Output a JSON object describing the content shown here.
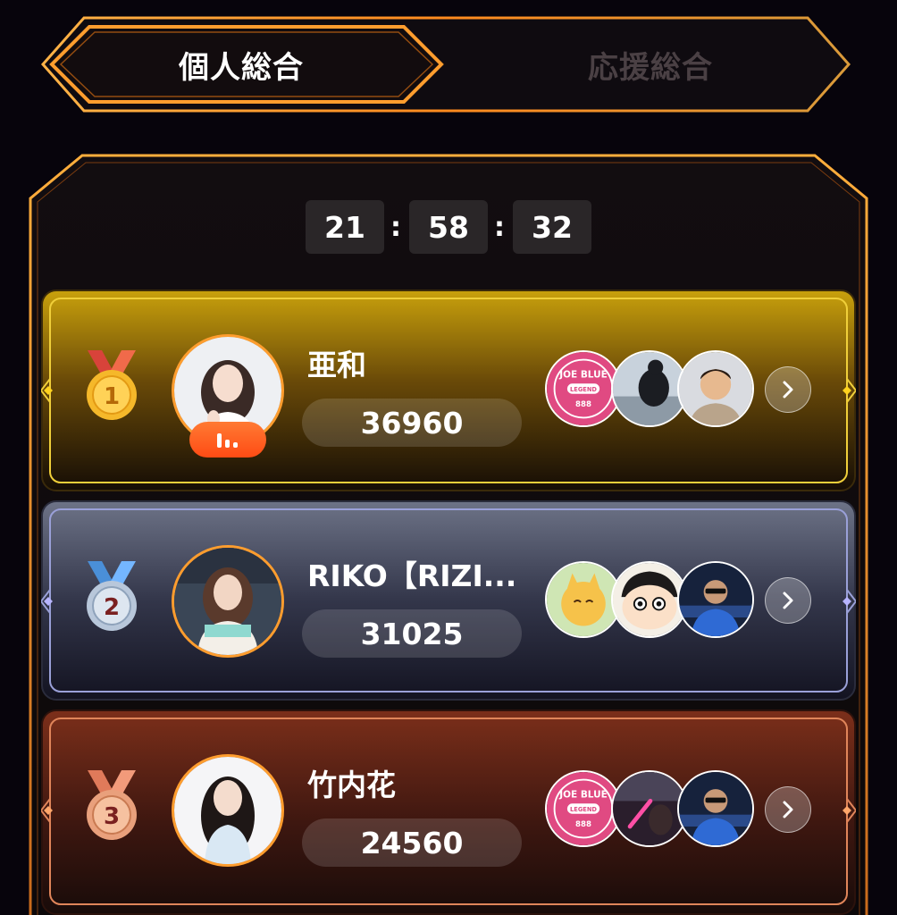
{
  "tabs": [
    {
      "label": "個人総合",
      "active": true
    },
    {
      "label": "応援総合",
      "active": false
    }
  ],
  "timer": {
    "hours": "21",
    "minutes": "58",
    "seconds": "32",
    "separator": ":"
  },
  "ranking": [
    {
      "rank": "1",
      "name": "亜和",
      "score": "36960",
      "theme": "gold",
      "live": true,
      "supporters": [
        "joe-blue-logo-avatar",
        "silhouette-photo-avatar",
        "man-photo-avatar"
      ]
    },
    {
      "rank": "2",
      "name": "RIKO【RIZI...",
      "score": "31025",
      "theme": "silver",
      "live": false,
      "supporters": [
        "yellow-creature-avatar",
        "cartoon-boy-avatar",
        "man-sunglasses-avatar"
      ]
    },
    {
      "rank": "3",
      "name": "竹内花",
      "score": "24560",
      "theme": "bronze",
      "live": false,
      "supporters": [
        "joe-blue-logo-avatar",
        "lightstick-photo-avatar",
        "man-sunglasses-avatar"
      ]
    }
  ],
  "joe_blue_logo": {
    "top": "JOE BLUE",
    "middle": "LEGEND",
    "bottom": "888"
  },
  "colors": {
    "accent": "#ff9d2e",
    "gold": "#c99a0c",
    "silver": "#6e7590",
    "bronze": "#7a2f1c",
    "background": "#07040c"
  }
}
